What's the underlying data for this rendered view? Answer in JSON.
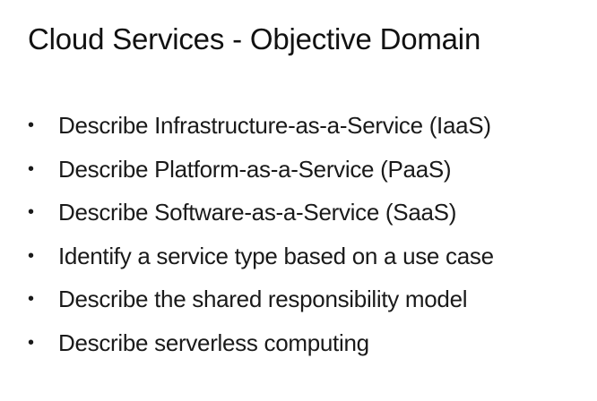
{
  "slide": {
    "title": "Cloud Services - Objective Domain",
    "bullets": [
      "Describe Infrastructure-as-a-Service (IaaS)",
      "Describe Platform-as-a-Service (PaaS)",
      "Describe Software-as-a-Service (SaaS)",
      "Identify a service type based on a use case",
      "Describe the shared responsibility model",
      "Describe serverless computing"
    ],
    "bullet_marker": "•"
  }
}
